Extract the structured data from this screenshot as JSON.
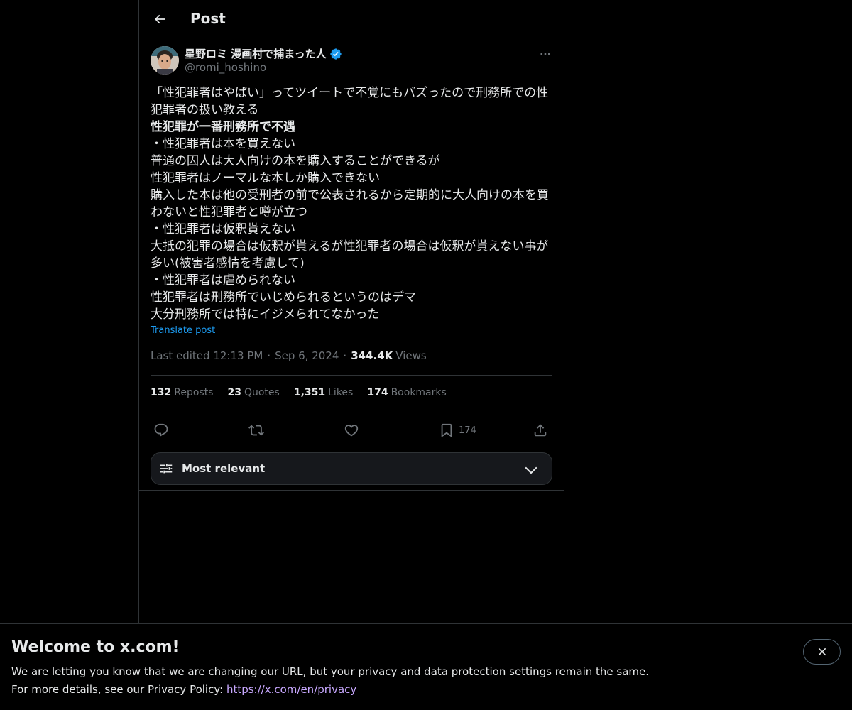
{
  "header": {
    "title": "Post"
  },
  "author": {
    "display_name": "星野ロミ 漫画村で捕まった人",
    "handle": "@romi_hoshino"
  },
  "tweet": {
    "lines": [
      "「性犯罪者はやばい」ってツイートで不覚にもバズったので刑務所での性",
      "犯罪者の扱い教える",
      "性犯罪が一番刑務所で不遇",
      "・性犯罪者は本を買えない",
      "普通の囚人は大人向けの本を購入することができるが",
      "性犯罪者はノーマルな本しか購入できない",
      "購入した本は他の受刑者の前で公表されるから定期的に大人向けの本を買",
      "わないと性犯罪者と噂が立つ",
      "・性犯罪者は仮釈貰えない",
      "大抵の犯罪の場合は仮釈が貰えるが性犯罪者の場合は仮釈が貰えない事が",
      "多い(被害者感情を考慮して)",
      "・性犯罪者は虐められない",
      "性犯罪者は刑務所でいじめられるというのはデマ",
      "大分刑務所では特にイジメられてなかった"
    ],
    "translate_label": "Translate post"
  },
  "meta": {
    "edited": "Last edited 12:13 PM",
    "sep1": "·",
    "date": "Sep 6, 2024",
    "sep2": "·",
    "views_count": "344.4K",
    "views_label": "Views"
  },
  "stats": {
    "reposts": {
      "count": "132",
      "label": "Reposts"
    },
    "quotes": {
      "count": "23",
      "label": "Quotes"
    },
    "likes": {
      "count": "1,351",
      "label": "Likes"
    },
    "bookmarks": {
      "count": "174",
      "label": "Bookmarks"
    }
  },
  "actions": {
    "bookmark_count": "174"
  },
  "sort": {
    "label": "Most relevant"
  },
  "banner": {
    "title": "Welcome to x.com!",
    "text1": "We are letting you know that we are changing our URL, but your privacy and data protection settings remain the same.",
    "text2_prefix": "For more details, see our Privacy Policy: ",
    "link": "https://x.com/en/privacy"
  },
  "colors": {
    "background": "#000000",
    "text": "#e7e9ea",
    "muted": "#71767b",
    "accent": "#1d9bf0",
    "border": "#2f3336"
  },
  "icons": [
    "back-arrow-icon",
    "verified-badge-icon",
    "more-icon",
    "reply-icon",
    "repost-icon",
    "like-icon",
    "bookmark-icon",
    "share-icon",
    "sliders-icon",
    "chevron-down-icon",
    "close-icon"
  ]
}
